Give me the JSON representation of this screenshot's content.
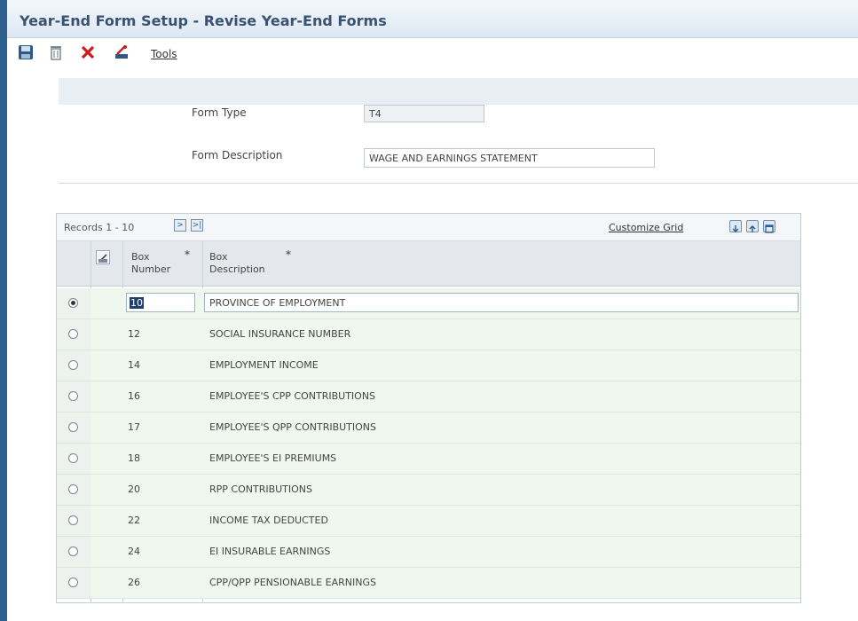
{
  "window": {
    "title": "Year-End Form Setup - Revise Year-End Forms"
  },
  "toolbar": {
    "tools_label": "Tools",
    "icons": [
      "save-icon",
      "delete-icon",
      "cancel-icon",
      "tools-icon"
    ]
  },
  "form": {
    "form_type_label": "Form Type",
    "form_type_value": "T4",
    "form_desc_label": "Form Description",
    "form_desc_value": "WAGE AND EARNINGS STATEMENT"
  },
  "grid": {
    "records_text": "Records 1 - 10",
    "customize_label": "Customize Grid",
    "col_box_number": [
      "Box",
      "Number"
    ],
    "col_box_desc": [
      "Box",
      "Description"
    ],
    "rows": [
      {
        "number": "10",
        "description": "PROVINCE OF EMPLOYMENT",
        "selected": true
      },
      {
        "number": "12",
        "description": "SOCIAL INSURANCE NUMBER",
        "selected": false
      },
      {
        "number": "14",
        "description": "EMPLOYMENT INCOME",
        "selected": false
      },
      {
        "number": "16",
        "description": "EMPLOYEE'S CPP CONTRIBUTIONS",
        "selected": false
      },
      {
        "number": "17",
        "description": "EMPLOYEE'S QPP CONTRIBUTIONS",
        "selected": false
      },
      {
        "number": "18",
        "description": "EMPLOYEE'S EI PREMIUMS",
        "selected": false
      },
      {
        "number": "20",
        "description": "RPP CONTRIBUTIONS",
        "selected": false
      },
      {
        "number": "22",
        "description": "INCOME TAX DEDUCTED",
        "selected": false
      },
      {
        "number": "24",
        "description": "EI INSURABLE EARNINGS",
        "selected": false
      },
      {
        "number": "26",
        "description": "CPP/QPP PENSIONABLE EARNINGS",
        "selected": false
      }
    ]
  },
  "colors": {
    "title": "#3a5270",
    "row_bg": "#eff7ef",
    "accent": "#2f5f8f"
  }
}
